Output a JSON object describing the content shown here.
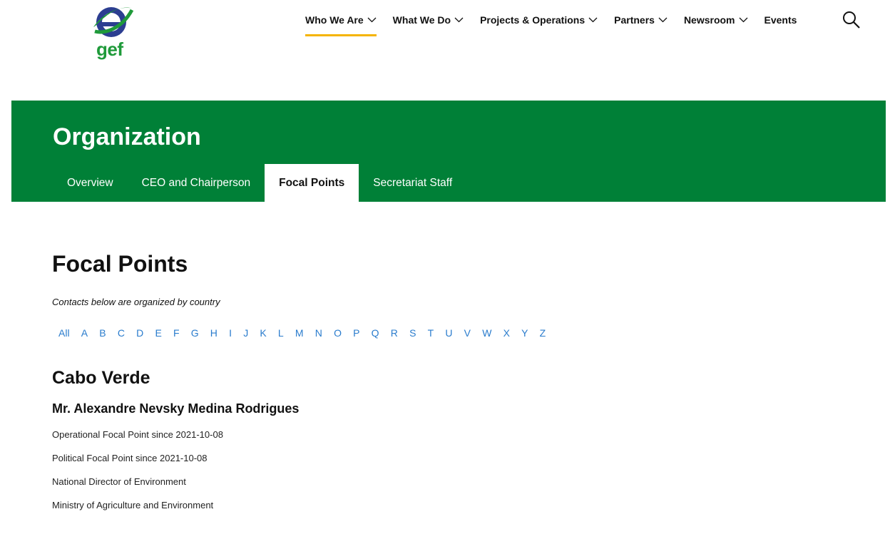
{
  "logo": {
    "text": "gef",
    "icon": "globe-logo"
  },
  "nav": {
    "items": [
      {
        "label": "Who We Are",
        "dropdown": true,
        "active": true
      },
      {
        "label": "What We Do",
        "dropdown": true
      },
      {
        "label": "Projects & Operations",
        "dropdown": true
      },
      {
        "label": "Partners",
        "dropdown": true
      },
      {
        "label": "Newsroom",
        "dropdown": true
      },
      {
        "label": "Events",
        "dropdown": false
      }
    ],
    "search_icon": "search-icon"
  },
  "banner": {
    "title": "Organization",
    "tabs": [
      {
        "label": "Overview"
      },
      {
        "label": "CEO and Chairperson"
      },
      {
        "label": "Focal Points",
        "active": true
      },
      {
        "label": "Secretariat Staff"
      }
    ]
  },
  "main": {
    "title": "Focal Points",
    "subtitle": "Contacts below are organized by country",
    "alphabet": [
      "All",
      "A",
      "B",
      "C",
      "D",
      "E",
      "F",
      "G",
      "H",
      "I",
      "J",
      "K",
      "L",
      "M",
      "N",
      "O",
      "P",
      "Q",
      "R",
      "S",
      "T",
      "U",
      "V",
      "W",
      "X",
      "Y",
      "Z"
    ],
    "country": "Cabo Verde",
    "person": {
      "name": "Mr. Alexandre Nevsky Medina Rodrigues",
      "details": [
        "Operational Focal Point since 2021-10-08",
        "Political Focal Point since 2021-10-08",
        "National Director of Environment",
        "Ministry of Agriculture and Environment"
      ]
    }
  },
  "colors": {
    "brand_green": "#008037",
    "accent_yellow": "#f5b400",
    "link_blue": "#2a7ccd"
  }
}
